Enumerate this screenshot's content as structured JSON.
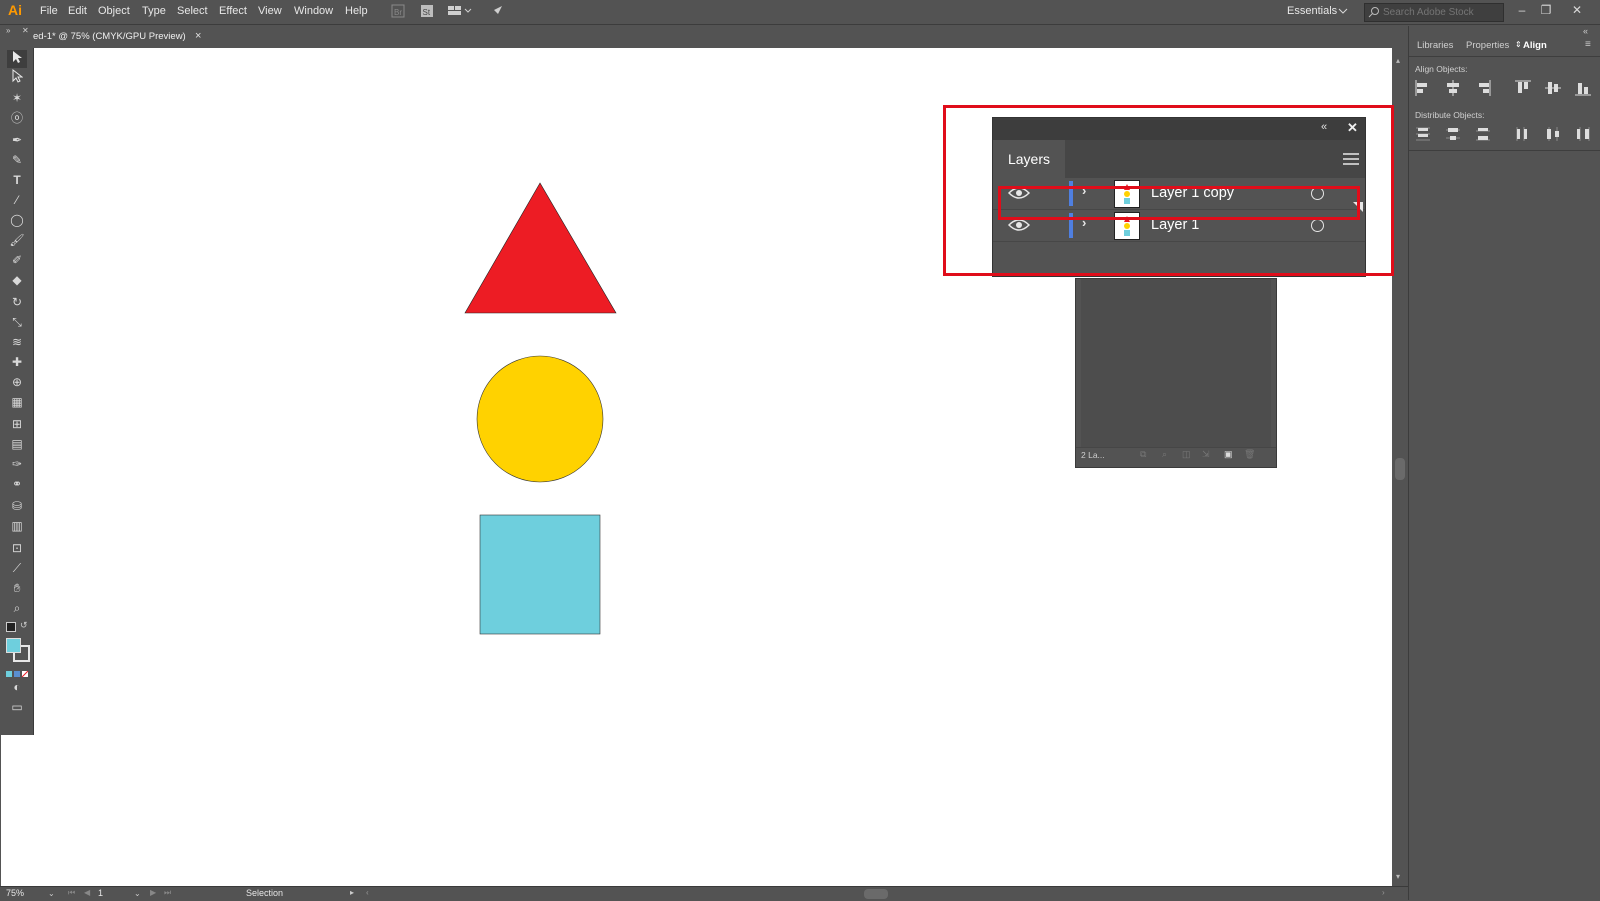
{
  "app": {
    "logo": "Ai"
  },
  "menu": [
    "File",
    "Edit",
    "Object",
    "Type",
    "Select",
    "Effect",
    "View",
    "Window",
    "Help"
  ],
  "toolbar_right": {
    "workspace": "Essentials",
    "search_placeholder": "Search Adobe Stock"
  },
  "document_tab": {
    "title": "ed-1* @ 75% (CMYK/GPU Preview)",
    "close": "×"
  },
  "right_panel": {
    "tabs": [
      "Libraries",
      "Properties",
      "Align"
    ],
    "active_tab": "Align",
    "align_objects_label": "Align Objects:",
    "distribute_objects_label": "Distribute Objects:"
  },
  "layers_panel": {
    "title": "Layers",
    "layers": [
      {
        "name": "Layer 1 copy",
        "selected": true
      },
      {
        "name": "Layer 1",
        "selected": false
      }
    ],
    "footer_count": "2 La..."
  },
  "canvas_shapes": {
    "triangle_color": "#ed1c24",
    "circle_color": "#ffd200",
    "square_color": "#6ecfdd"
  },
  "status_bar": {
    "zoom": "75%",
    "page": "1",
    "tool": "Selection"
  },
  "colors": {
    "highlight": "#e00d1a",
    "ui_bg": "#535353",
    "accent_layer": "#4f7fe0"
  }
}
